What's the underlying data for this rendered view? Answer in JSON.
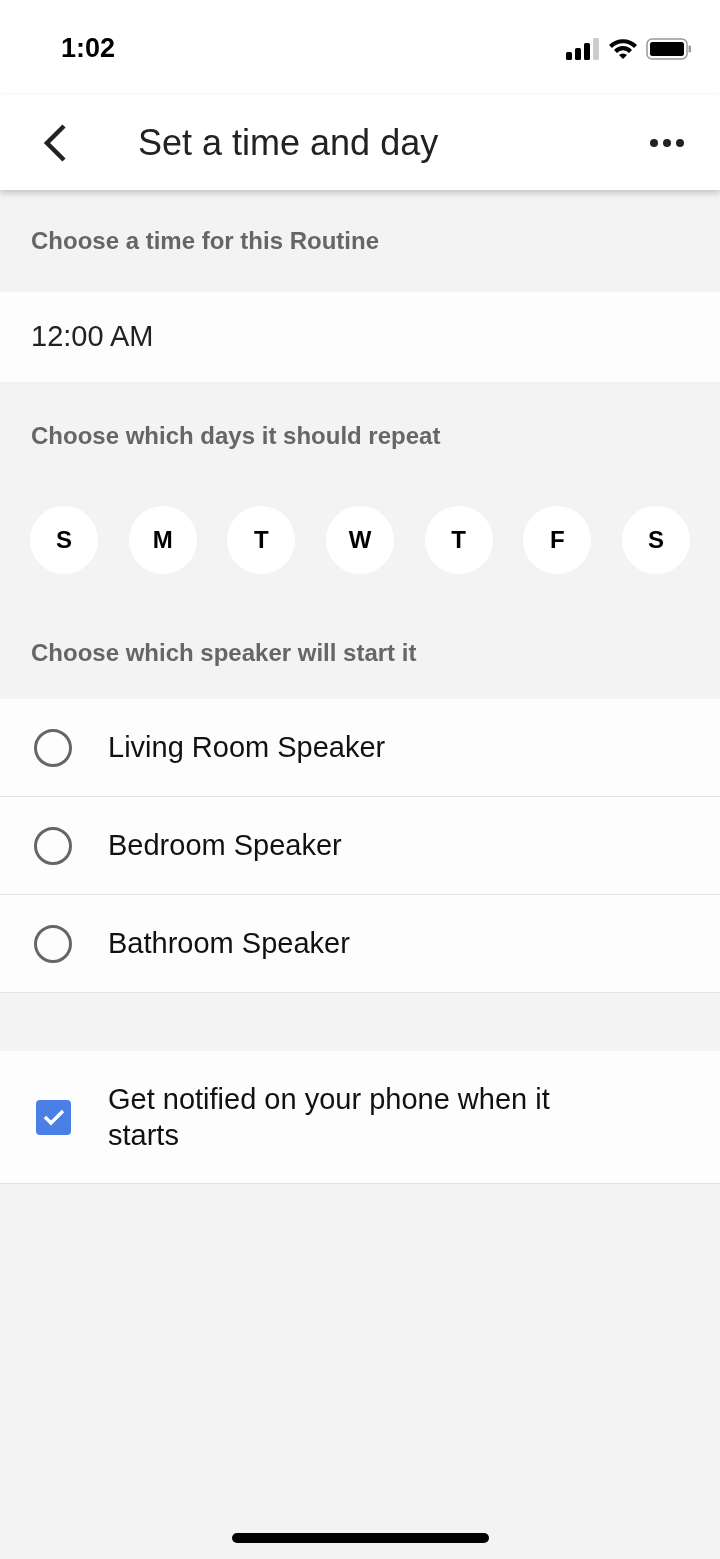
{
  "status_bar": {
    "time": "1:02"
  },
  "header": {
    "title": "Set a time and day"
  },
  "time_section": {
    "label": "Choose a time for this Routine",
    "value": "12:00 AM"
  },
  "days_section": {
    "label": "Choose which days it should repeat",
    "days": [
      {
        "label": "S",
        "selected": false
      },
      {
        "label": "M",
        "selected": false
      },
      {
        "label": "T",
        "selected": false
      },
      {
        "label": "W",
        "selected": false
      },
      {
        "label": "T",
        "selected": false
      },
      {
        "label": "F",
        "selected": false
      },
      {
        "label": "S",
        "selected": false
      }
    ]
  },
  "speaker_section": {
    "label": "Choose which speaker will start it",
    "speakers": [
      {
        "name": "Living Room Speaker",
        "selected": false
      },
      {
        "name": "Bedroom Speaker",
        "selected": false
      },
      {
        "name": "Bathroom Speaker",
        "selected": false
      }
    ]
  },
  "notification": {
    "label": "Get notified on your phone when it starts",
    "checked": true
  }
}
